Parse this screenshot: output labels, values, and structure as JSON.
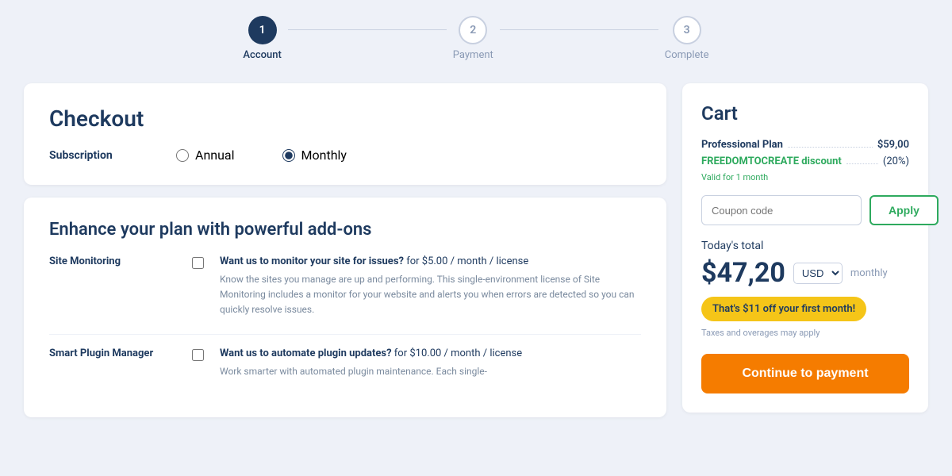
{
  "stepper": {
    "steps": [
      {
        "number": "1",
        "label": "Account",
        "state": "active"
      },
      {
        "number": "2",
        "label": "Payment",
        "state": "inactive"
      },
      {
        "number": "3",
        "label": "Complete",
        "state": "inactive"
      }
    ]
  },
  "checkout": {
    "title": "Checkout",
    "subscription_label": "Subscription",
    "annual_option": "Annual",
    "monthly_option": "Monthly"
  },
  "addons": {
    "title": "Enhance your plan with powerful add-ons",
    "items": [
      {
        "name": "Site Monitoring",
        "title_strong": "Want us to monitor your site for issues?",
        "title_rest": " for $5.00 / month / license",
        "description": "Know the sites you manage are up and performing. This single-environment license of Site Monitoring includes a monitor for your website and alerts you when errors are detected so you can quickly resolve issues."
      },
      {
        "name": "Smart Plugin Manager",
        "title_strong": "Want us to automate plugin updates?",
        "title_rest": " for $10.00 / month / license",
        "description": "Work smarter with automated plugin maintenance. Each single-"
      }
    ]
  },
  "cart": {
    "title": "Cart",
    "plan_name": "Professional Plan",
    "plan_price": "$59,00",
    "discount_name": "FREEDOMTOCREATE discount",
    "discount_value": "(20%)",
    "discount_valid": "Valid for 1 month",
    "coupon_placeholder": "Coupon code",
    "apply_label": "Apply",
    "todays_total_label": "Today's total",
    "total_price": "$47,20",
    "currency": "USD",
    "monthly_label": "monthly",
    "savings_badge": "That's $11 off your first month!",
    "taxes_note": "Taxes and overages may apply",
    "continue_label": "Continue to payment"
  }
}
